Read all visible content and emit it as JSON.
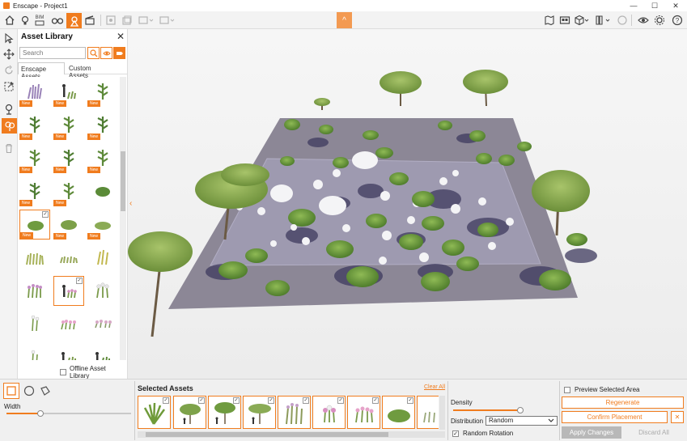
{
  "window": {
    "title": "Enscape - Project1",
    "controls": [
      "—",
      "☐",
      "✕"
    ]
  },
  "toolbar": {
    "left_icons": [
      "home-icon",
      "bulb-icon",
      "bim-icon",
      "binoculars-icon",
      "asset-library-icon",
      "clapper-icon",
      "snapshot-icon",
      "batch-render-icon",
      "export-icon",
      "export-video-icon"
    ],
    "bim_label": "BIM",
    "right_icons": [
      "map-icon",
      "vr-icon",
      "cube-icon",
      "books-icon",
      "settings-round-icon",
      "eye-icon",
      "gear-icon",
      "help-icon"
    ],
    "collapse_glyph": "^"
  },
  "left_tools": [
    "select-arrow-icon",
    "move-icon",
    "rotate-icon",
    "scale-icon",
    "place-asset-icon",
    "scatter-asset-icon",
    "trash-icon"
  ],
  "asset_library": {
    "title": "Asset Library",
    "close_glyph": "✕",
    "search_placeholder": "Search",
    "tabs": [
      "Enscape Assets",
      "Custom Assets"
    ],
    "new_tag": "New",
    "offline_label": "Offline Asset Library",
    "check_glyph": "✓"
  },
  "scatter": {
    "width_label": "Width",
    "width_value": 0.27,
    "selected_assets_title": "Selected Assets",
    "clear_all": "Clear All",
    "density_label": "Density",
    "density_value": 0.97,
    "distribution_label": "Distribution",
    "distribution_value": "Random",
    "random_rotation_label": "Random Rotation",
    "random_rotation_checked": true,
    "preview_label": "Preview Selected Area",
    "preview_checked": false,
    "regenerate": "Regenerate",
    "confirm_placement": "Confirm Placement",
    "apply_changes": "Apply Changes",
    "discard_all": "Discard All",
    "remove_glyph": "✕"
  },
  "colors": {
    "accent": "#f07c1e",
    "ground": "#8c8796",
    "selected_area": "#9e9ab0",
    "foliage": "#6c9a3c"
  }
}
